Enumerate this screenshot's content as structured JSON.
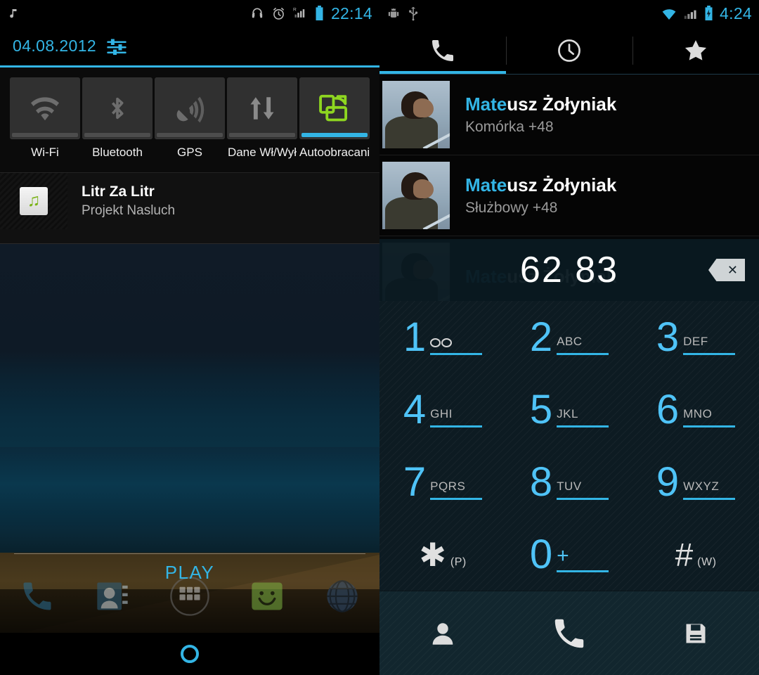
{
  "left_panel": {
    "status_bar": {
      "icons_left": [
        "music-note-icon"
      ],
      "icons_right": [
        "headphones-icon",
        "alarm-icon",
        "signal-roaming-icon",
        "battery-icon"
      ],
      "clock": "22:14"
    },
    "shade": {
      "date": "04.08.2012",
      "settings_icon": "settings-sliders-icon",
      "quick_settings": [
        {
          "label": "Wi-Fi",
          "icon": "wifi-icon",
          "active": false
        },
        {
          "label": "Bluetooth",
          "icon": "bluetooth-icon",
          "active": false
        },
        {
          "label": "GPS",
          "icon": "gps-icon",
          "active": false
        },
        {
          "label": "Dane Wł/Wył",
          "icon": "data-transfer-icon",
          "active": false
        },
        {
          "label": "Autoobracanie",
          "icon": "autorotate-icon",
          "active": true
        }
      ],
      "notification": {
        "icon": "music-note-icon",
        "title": "Litr Za Litr",
        "subtitle": "Projekt Nasluch"
      }
    },
    "home": {
      "drawer_label": "PLAY",
      "dock_icons": [
        "phone-icon",
        "contacts-icon",
        "app-drawer-icon",
        "play-store-icon",
        "browser-icon"
      ],
      "nav_home_icon": "home-ring-icon"
    },
    "accent_color": "#33b5e5"
  },
  "right_panel": {
    "status_bar": {
      "icons_left": [
        "android-debug-icon",
        "usb-icon"
      ],
      "icons_right": [
        "wifi-icon",
        "signal-icon",
        "battery-charging-icon"
      ],
      "clock": "4:24"
    },
    "tabs": [
      {
        "name": "dialer",
        "icon": "phone-icon",
        "active": true
      },
      {
        "name": "recents",
        "icon": "clock-icon",
        "active": false
      },
      {
        "name": "favorites",
        "icon": "star-icon",
        "active": false
      }
    ],
    "contacts": [
      {
        "name_match": "Mate",
        "name_rest": "usz Żołyniak",
        "type": "Komórka",
        "number_visible": "+48",
        "number_faded": ""
      },
      {
        "name_match": "Mate",
        "name_rest": "usz Żołyniak",
        "type": "Służbowy",
        "number_visible": "+48",
        "number_faded": ""
      },
      {
        "name_match": "Mate",
        "name_rest": "usz Żołyniak",
        "type": "",
        "number_visible": "",
        "number_faded": ""
      }
    ],
    "dial_display": {
      "value": "62 83",
      "backspace_icon": "backspace-icon",
      "backspace_glyph": "✕"
    },
    "keypad": [
      {
        "digit": "1",
        "letters": "",
        "voicemail": true
      },
      {
        "digit": "2",
        "letters": "ABC"
      },
      {
        "digit": "3",
        "letters": "DEF"
      },
      {
        "digit": "4",
        "letters": "GHI"
      },
      {
        "digit": "5",
        "letters": "JKL"
      },
      {
        "digit": "6",
        "letters": "MNO"
      },
      {
        "digit": "7",
        "letters": "PQRS"
      },
      {
        "digit": "8",
        "letters": "TUV"
      },
      {
        "digit": "9",
        "letters": "WXYZ"
      },
      {
        "digit": "✱",
        "letters": "(P)",
        "symbol": true
      },
      {
        "digit": "0",
        "letters": "+",
        "plus": true
      },
      {
        "digit": "#",
        "letters": "(W)",
        "symbol": true
      }
    ],
    "actions": [
      {
        "name": "add-contact",
        "icon": "person-icon"
      },
      {
        "name": "call",
        "icon": "phone-icon"
      },
      {
        "name": "save-number",
        "icon": "save-icon"
      }
    ],
    "accent_color": "#33b5e5"
  }
}
